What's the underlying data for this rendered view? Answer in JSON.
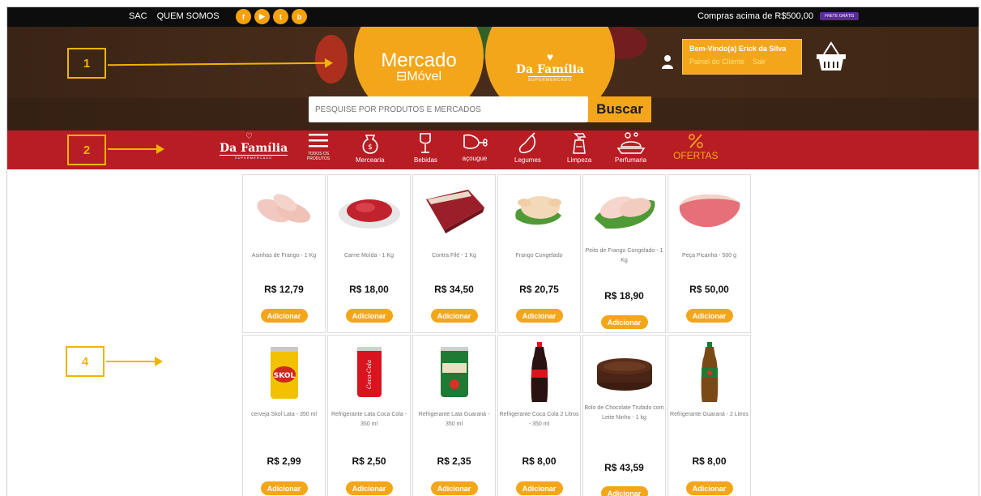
{
  "topbar": {
    "sac": "SAC",
    "quem_somos": "QUEM SOMOS",
    "social": [
      "f",
      "▶",
      "t",
      "b"
    ],
    "promo_text": "Compras acima de R$500,00",
    "promo_badge": "FRETE GRÁTIS"
  },
  "hero": {
    "logo1_line1": "Mercado",
    "logo1_line2": "Móvel",
    "logo2_line1": "Da Família",
    "logo2_line2": "SUPERMERCADO",
    "welcome": "Bem-Vindo(a) Erick da Silva",
    "panel_link": "Painel do Cliente",
    "logout_link": "Sair",
    "search_placeholder": "PESQUISE POR PRODUTOS E MERCADOS",
    "search_button": "Buscar"
  },
  "nav": {
    "logo_line1": "Da Família",
    "logo_line2": "SUPERMERCADO",
    "items": [
      {
        "label": "TODOS OS PRODUTOS",
        "icon": "menu-icon"
      },
      {
        "label": "Mercearia",
        "icon": "bag-icon"
      },
      {
        "label": "Bebidas",
        "icon": "wine-glass-icon"
      },
      {
        "label": "açougue",
        "icon": "meat-icon"
      },
      {
        "label": "Legumes",
        "icon": "eggplant-icon"
      },
      {
        "label": "Limpeza",
        "icon": "spray-bottle-icon"
      },
      {
        "label": "Perfumaria",
        "icon": "perfume-icon"
      },
      {
        "label": "OFERTAS",
        "icon": "percent-icon"
      }
    ]
  },
  "markers": [
    "1",
    "2",
    "4"
  ],
  "add_label": "Adicionar",
  "products_row1": [
    {
      "name": "Asinhas de Frango - 1 Kg",
      "price": "R$ 12,79",
      "img": "chicken-wings-image"
    },
    {
      "name": "Carne Moída - 1 Kg",
      "price": "R$ 18,00",
      "img": "ground-beef-image"
    },
    {
      "name": "Contra Filé - 1 Kg",
      "price": "R$ 34,50",
      "img": "sirloin-image"
    },
    {
      "name": "Frango Congelado",
      "price": "R$ 20,75",
      "img": "frozen-chicken-image"
    },
    {
      "name": "Peito de Frango Congelado - 1 Kg",
      "price": "R$ 18,90",
      "img": "chicken-breast-image"
    },
    {
      "name": "Peça Picanha - 500 g",
      "price": "R$ 50,00",
      "img": "picanha-image"
    }
  ],
  "products_row2": [
    {
      "name": "cerveja Skol Lata - 350 ml",
      "price": "R$ 2,99",
      "img": "skol-can-image"
    },
    {
      "name": "Refrigerante Lata Coca Cola - 350 ml",
      "price": "R$ 2,50",
      "img": "coca-can-image"
    },
    {
      "name": "Refrigerante Lata Guaraná - 350 ml",
      "price": "R$ 2,35",
      "img": "guarana-can-image"
    },
    {
      "name": "Refrigerante Coca Cola 2 Litros - 350 ml",
      "price": "R$ 8,00",
      "img": "coca-bottle-image"
    },
    {
      "name": "Bolo de Chocolate Trufado com Leite Ninho - 1 kg",
      "price": "R$ 43,59",
      "img": "chocolate-cake-image"
    },
    {
      "name": "Refrigerante Guaraná - 2 Litros",
      "price": "R$ 8,00",
      "img": "guarana-bottle-image"
    }
  ],
  "colors": {
    "orange": "#f4a61a",
    "red": "#b81d24",
    "dark": "#0d0d0d",
    "marker": "#f0b400"
  }
}
